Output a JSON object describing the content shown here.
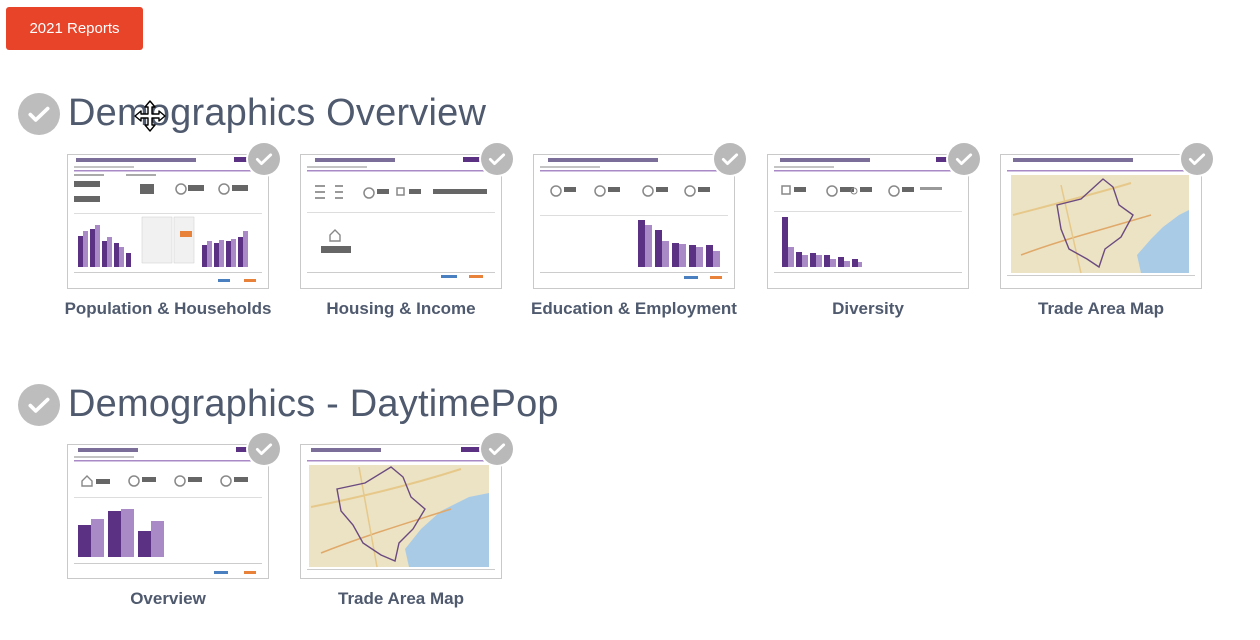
{
  "top_button": {
    "label": "2021 Reports"
  },
  "sections": [
    {
      "title": "Demographics Overview",
      "cards": [
        {
          "label": "Population & Households"
        },
        {
          "label": "Housing & Income"
        },
        {
          "label": "Education & Employment"
        },
        {
          "label": "Diversity"
        },
        {
          "label": "Trade Area Map"
        }
      ]
    },
    {
      "title": "Demographics - DaytimePop",
      "cards": [
        {
          "label": "Overview"
        },
        {
          "label": "Trade Area Map"
        }
      ]
    }
  ],
  "colors": {
    "button": "#e8442a",
    "heading": "#4f5a6e",
    "check_badge": "#bdbdbd",
    "bar_dark": "#5b3184",
    "bar_light": "#a98ac7"
  }
}
